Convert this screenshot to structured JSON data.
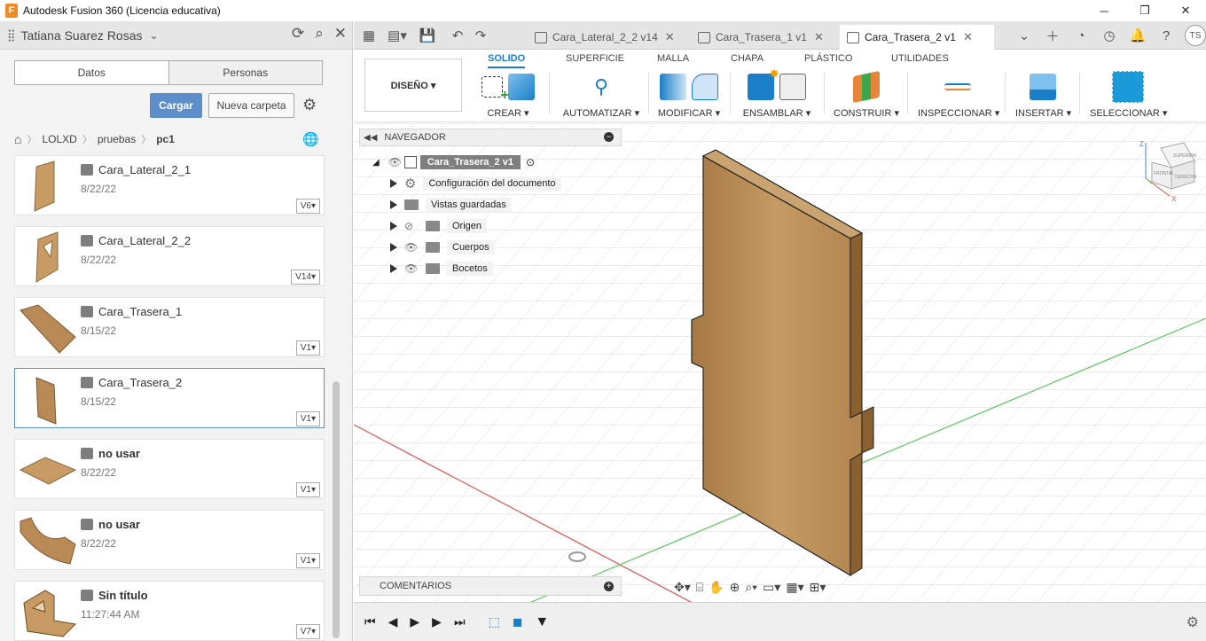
{
  "window": {
    "title": "Autodesk Fusion 360 (Licencia educativa)",
    "app_icon_letter": "F"
  },
  "data_panel": {
    "team_name": "Tatiana Suarez Rosas",
    "tabs": {
      "data": "Datos",
      "people": "Personas"
    },
    "upload_label": "Cargar",
    "new_folder_label": "Nueva carpeta",
    "breadcrumb": [
      "LOLXD",
      "pruebas",
      "pc1"
    ],
    "files": [
      {
        "name": "Cara_Lateral_2_1",
        "date": "8/22/22",
        "version": "V6"
      },
      {
        "name": "Cara_Lateral_2_2",
        "date": "8/22/22",
        "version": "V14"
      },
      {
        "name": "Cara_Trasera_1",
        "date": "8/15/22",
        "version": "V1"
      },
      {
        "name": "Cara_Trasera_2",
        "date": "8/15/22",
        "version": "V1"
      },
      {
        "name": "no usar",
        "date": "8/22/22",
        "version": "V1"
      },
      {
        "name": "no usar",
        "date": "8/22/22",
        "version": "V1"
      },
      {
        "name": "Sin título",
        "date": "11:27:44 AM",
        "version": "V7"
      }
    ]
  },
  "doc_tabs": [
    {
      "label": "Cara_Lateral_2_2 v14"
    },
    {
      "label": "Cara_Trasera_1 v1"
    },
    {
      "label": "Cara_Trasera_2 v1"
    }
  ],
  "user_initials": "TS",
  "ribbon": {
    "workspace": "DISEÑO ▾",
    "tabs": [
      "SOLIDO",
      "SUPERFICIE",
      "MALLA",
      "CHAPA",
      "PLÁSTICO",
      "UTILIDADES"
    ],
    "groups": [
      "CREAR ▾",
      "AUTOMATIZAR ▾",
      "MODIFICAR ▾",
      "ENSAMBLAR ▾",
      "CONSTRUIR ▾",
      "INSPECCIONAR ▾",
      "INSERTAR ▾",
      "SELECCIONAR ▾"
    ]
  },
  "navigator": {
    "title": "NAVEGADOR",
    "root": "Cara_Trasera_2 v1",
    "items": [
      "Configuración del documento",
      "Vistas guardadas",
      "Origen",
      "Cuerpos",
      "Bocetos"
    ]
  },
  "comments_label": "COMENTARIOS",
  "viewcube": {
    "top": "SUPERIOR",
    "front": "FRONTAL",
    "right": "DERECHA"
  },
  "colors": {
    "accent": "#1a7ec8",
    "wood": "#b98a55",
    "upload": "#5c8fc9"
  }
}
